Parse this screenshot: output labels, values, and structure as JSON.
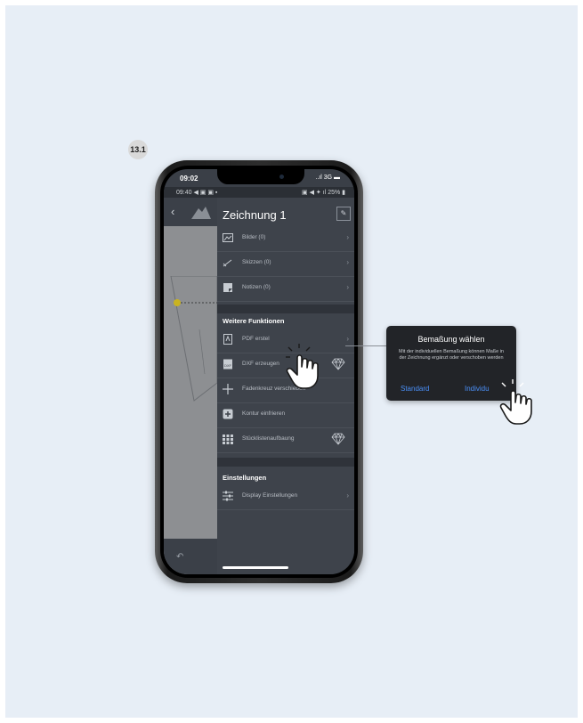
{
  "step_badge": "13.1",
  "phone": {
    "outer_time": "09:02",
    "outer_status": "..ıl 3G ▬",
    "inner_time": "09:40 ◀ ▣ ▣ ▪",
    "inner_status_right": "▣ ◀ ✦ ıl 25% ▮"
  },
  "menu": {
    "title": "Zeichnung 1",
    "items_top": [
      {
        "label": "Bilder (0)",
        "icon": "image-icon"
      },
      {
        "label": "Skizzen (0)",
        "icon": "sketch-icon"
      },
      {
        "label": "Notizen (0)",
        "icon": "note-icon"
      }
    ],
    "section_more": "Weitere Funktionen",
    "items_more": [
      {
        "label": "PDF erstel",
        "icon": "pdf-icon",
        "chevron": "›"
      },
      {
        "label": "DXF erzeugen",
        "icon": "dxf-icon",
        "premium": true
      },
      {
        "label": "Fadenkreuz verschieben",
        "icon": "crosshair-icon"
      },
      {
        "label": "Kontur einfrieren",
        "icon": "freeze-contour-icon"
      },
      {
        "label": "Stücklistenaufbaung",
        "icon": "parts-list-icon",
        "premium": true
      }
    ],
    "section_settings": "Einstellungen",
    "items_settings": [
      {
        "label": "Display Einstellungen",
        "icon": "sliders-icon",
        "chevron": "›"
      }
    ],
    "chevron": "›"
  },
  "dialog": {
    "title": "Bemaßung wählen",
    "message": "Mit der individuellen Bemaßung können Maße in der Zeichnung ergänzt oder verschoben werden",
    "btn_standard": "Standard",
    "btn_individual": "Individu"
  },
  "colors": {
    "background": "#e7eef6",
    "menu_bg": "#3e434b",
    "dialog_bg": "#222428",
    "dialog_button": "#4a8ff7",
    "marker": "#c9b320"
  }
}
